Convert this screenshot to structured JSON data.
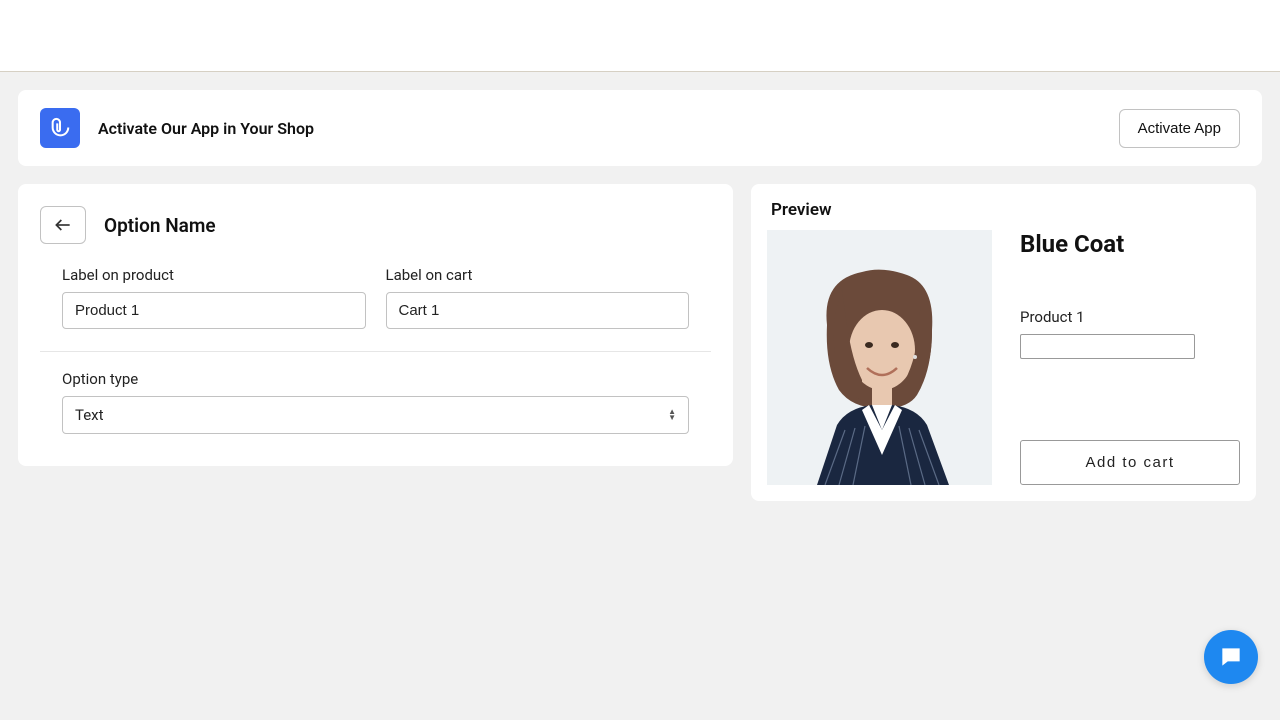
{
  "banner": {
    "text": "Activate Our App in Your Shop",
    "button": "Activate App"
  },
  "leftCard": {
    "title": "Option Name",
    "labelProduct": "Label on product",
    "labelProductValue": "Product 1",
    "labelCart": "Label on cart",
    "labelCartValue": "Cart 1",
    "optionType": "Option type",
    "optionTypeValue": "Text"
  },
  "preview": {
    "title": "Preview",
    "productTitle": "Blue Coat",
    "productLabel": "Product 1",
    "addToCart": "Add to cart"
  }
}
